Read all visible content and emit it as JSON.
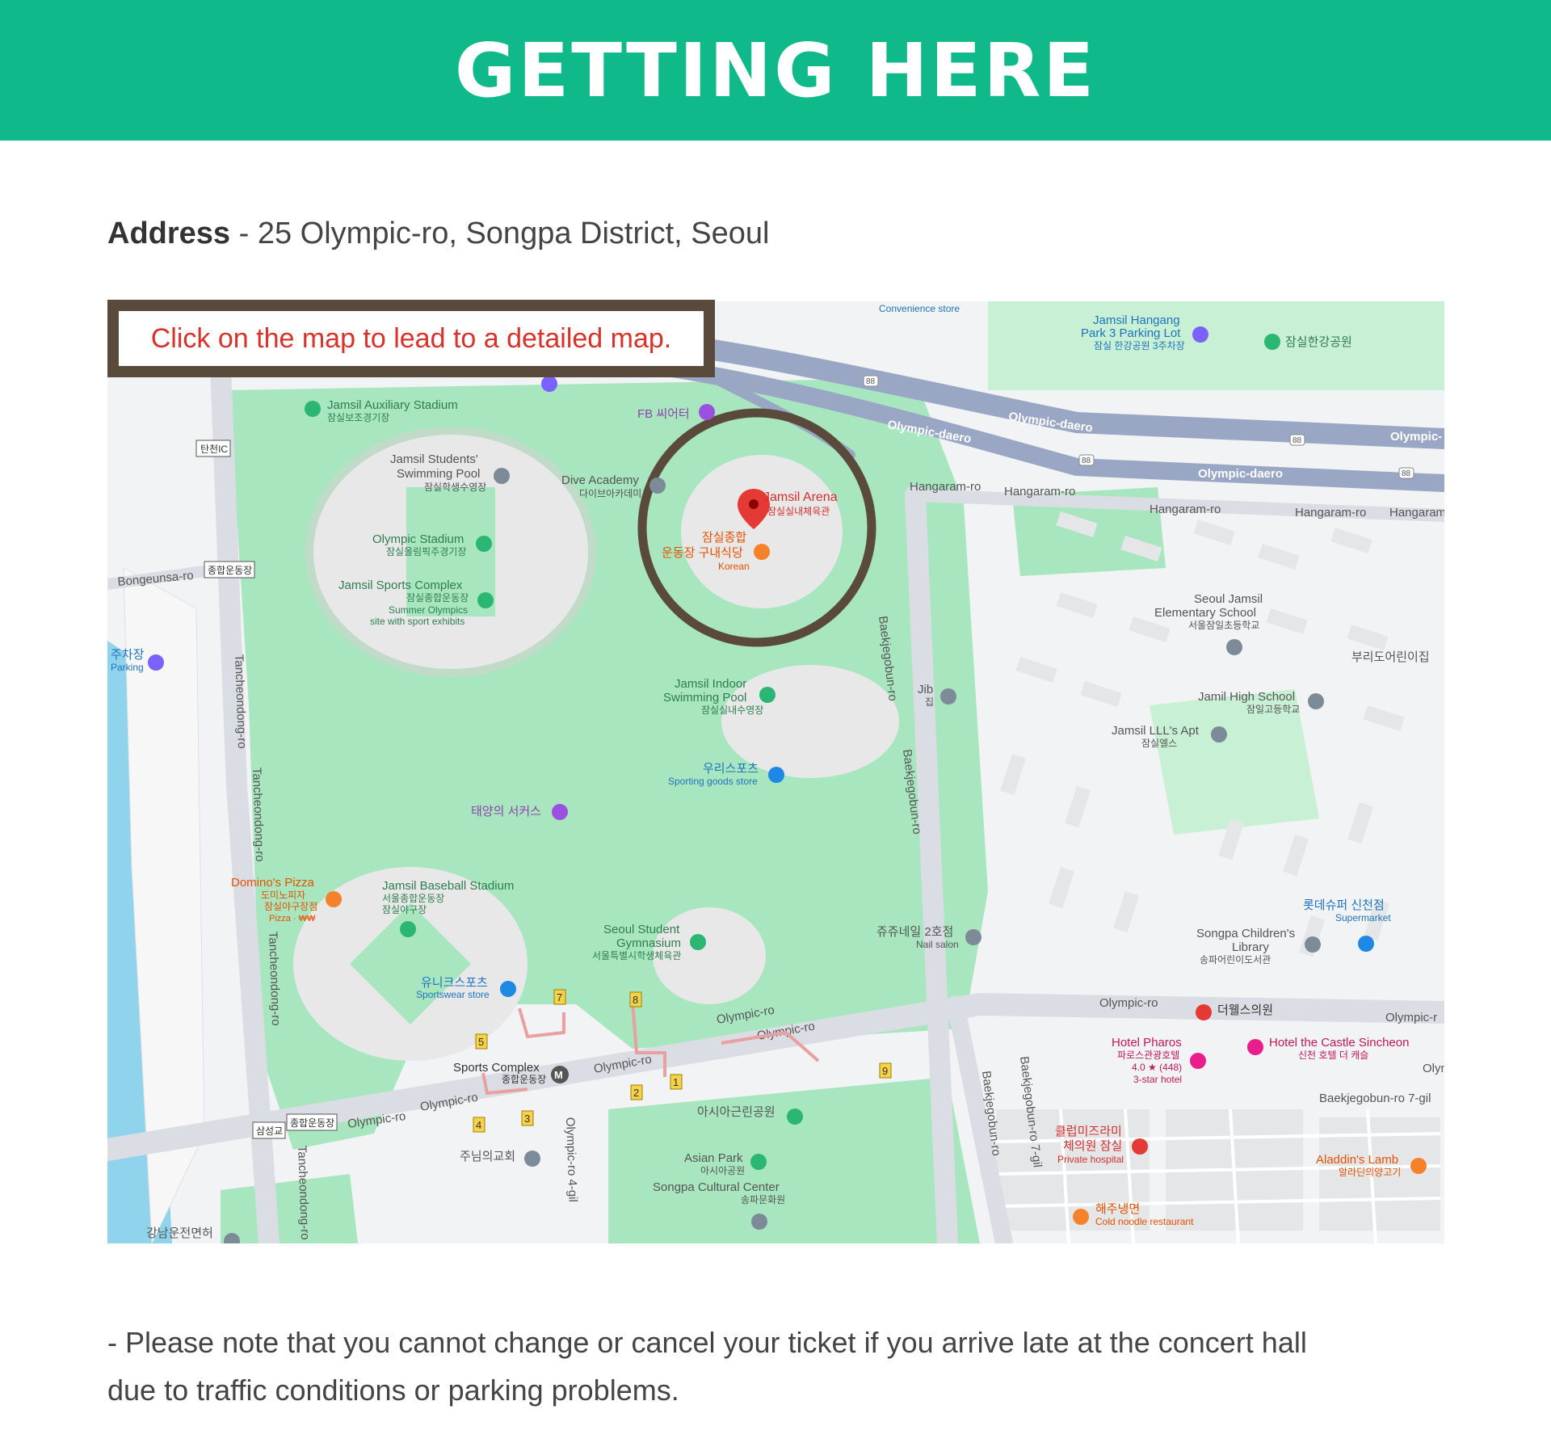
{
  "header": {
    "title": "GETTING HERE"
  },
  "address": {
    "label": "Address",
    "separator": " - ",
    "value": "25 Olympic-ro, Songpa District, Seoul"
  },
  "notice": {
    "text": "Click on the map to lead to a detailed map."
  },
  "note": {
    "text": "- Please note that you cannot change or cancel your ticket if you arrive late at the concert hall due to traffic conditions or parking problems."
  },
  "colors": {
    "brand": "#10b98a",
    "notice_text": "#d8322b",
    "frame": "#5a4a3c",
    "park": "#a8e6bf",
    "road": "#9aa7c4",
    "water": "#8fd4ec"
  },
  "map": {
    "venue": {
      "name": "Jamsil Arena",
      "name_ko": "잠실실내체육관"
    },
    "places": [
      {
        "name": "Jamsil Auxiliary Stadium",
        "sub": "잠실보조경기장"
      },
      {
        "name": "FB 씨어터",
        "sub": ""
      },
      {
        "name": "Jamsil Students'",
        "sub": "Swimming Pool"
      },
      {
        "name": "잠실학생수영장",
        "sub": ""
      },
      {
        "name": "Dive Academy",
        "sub": "다이브아카데미"
      },
      {
        "name": "Olympic Stadium",
        "sub": "잠실올림픽주경기장"
      },
      {
        "name": "Jamsil Sports Complex",
        "sub": "잠실종합운동장"
      },
      {
        "name": "Summer Olympics",
        "sub": "site with sport exhibits"
      },
      {
        "name": "잠실종합",
        "sub": "운동장 구내식당"
      },
      {
        "name": "Korean",
        "sub": ""
      },
      {
        "name": "Jamsil Indoor",
        "sub": "Swimming Pool"
      },
      {
        "name": "잠실실내수영장",
        "sub": ""
      },
      {
        "name": "우리스포츠",
        "sub": "Sporting goods store"
      },
      {
        "name": "태양의 서커스",
        "sub": ""
      },
      {
        "name": "Jamsil Baseball Stadium",
        "sub": "서울종합운동장"
      },
      {
        "name": "잠실야구장",
        "sub": ""
      },
      {
        "name": "Domino's Pizza",
        "sub": "도미노피자"
      },
      {
        "name": "잠실야구장점",
        "sub": "Pizza · ₩₩"
      },
      {
        "name": "Seoul Student",
        "sub": "Gymnasium"
      },
      {
        "name": "서울특별시학생체육관",
        "sub": ""
      },
      {
        "name": "유니크스포츠",
        "sub": "Sportswear store"
      },
      {
        "name": "Sports Complex",
        "sub": "종합운동장"
      },
      {
        "name": "아시아근린공원",
        "sub": ""
      },
      {
        "name": "Asian Park",
        "sub": "아시아공원"
      },
      {
        "name": "Songpa Cultural Center",
        "sub": "송파문화원"
      },
      {
        "name": "주님의교회",
        "sub": ""
      },
      {
        "name": "Jib",
        "sub": "집"
      },
      {
        "name": "쥬쥬네일 2호점",
        "sub": "Nail salon"
      },
      {
        "name": "Seoul Jamsil",
        "sub": "Elementary School"
      },
      {
        "name": "서울잠일초등학교",
        "sub": ""
      },
      {
        "name": "Jamil High School",
        "sub": "잠일고등학교"
      },
      {
        "name": "Jamsil LLL's Apt",
        "sub": "잠실엘스"
      },
      {
        "name": "부리도어린이집",
        "sub": ""
      },
      {
        "name": "Songpa Children's",
        "sub": "Library"
      },
      {
        "name": "송파어린이도서관",
        "sub": ""
      },
      {
        "name": "롯데슈퍼 신천점",
        "sub": "Supermarket"
      },
      {
        "name": "더웰스의원",
        "sub": ""
      },
      {
        "name": "Hotel Pharos",
        "sub": "파로스관광호텔"
      },
      {
        "name": "4.0 ★ (448)",
        "sub": "3-star hotel"
      },
      {
        "name": "Hotel the Castle Sincheon",
        "sub": "신천 호텔 더 캐슬"
      },
      {
        "name": "클럽미즈라미",
        "sub": "체의원 잠실"
      },
      {
        "name": "Private hospital",
        "sub": ""
      },
      {
        "name": "Aladdin's Lamb",
        "sub": "알라딘의양고기"
      },
      {
        "name": "해주냉면",
        "sub": "Cold noodle restaurant"
      },
      {
        "name": "Jamsil Hangang",
        "sub": "Park 3 Parking Lot"
      },
      {
        "name": "잠실 한강공원 3주차장",
        "sub": ""
      },
      {
        "name": "잠실한강공원",
        "sub": ""
      },
      {
        "name": "Convenience store",
        "sub": ""
      },
      {
        "name": "주차장",
        "sub": "Parking"
      },
      {
        "name": "강남운전면허",
        "sub": ""
      }
    ],
    "roads": [
      "Olympic-daero",
      "Olympic-daero",
      "Olympic-daero",
      "Olympic-",
      "Hangaram-ro",
      "Hangaram-ro",
      "Hangaram-ro",
      "Hangaram-ro",
      "Hangaram",
      "Baekjegobun-ro",
      "Baekjegobun-ro",
      "Baekjegobun-ro",
      "Baekjegobun-ro 7-gil",
      "Baekjegobun-ro 7-gil",
      "Olympic-ro",
      "Olympic-ro",
      "Olympic-ro",
      "Olympic-ro",
      "Olympic-ro",
      "Olympic-ro",
      "Olympic-ro 4-gil",
      "Olympic-r",
      "Olym",
      "Tancheondong-ro",
      "Tancheondong-ro",
      "Tancheondong-ro",
      "Tancheondong-ro",
      "Bongeunsa-ro"
    ],
    "road_signs": [
      "탄천IC",
      "종합운동장",
      "종합운동장",
      "삼성교"
    ],
    "route_numbers": [
      "88",
      "88",
      "88",
      "88"
    ],
    "exits": [
      "1",
      "2",
      "3",
      "4",
      "5",
      "7",
      "8",
      "9"
    ]
  }
}
